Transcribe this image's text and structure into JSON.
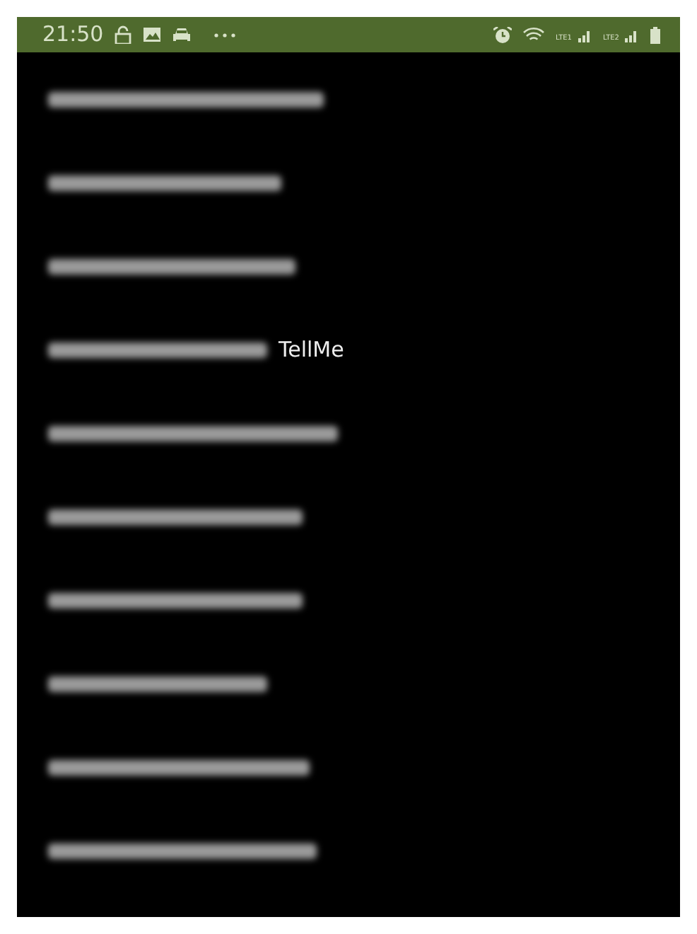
{
  "status_bar": {
    "time": "21:50",
    "sims": [
      {
        "label": "LTE1"
      },
      {
        "label": "LTE2"
      }
    ]
  },
  "devices": [
    {
      "kind": "blurred"
    },
    {
      "kind": "blurred"
    },
    {
      "kind": "blurred"
    },
    {
      "kind": "blurred_with_name",
      "name": "TellMe"
    },
    {
      "kind": "blurred"
    },
    {
      "kind": "blurred"
    },
    {
      "kind": "blurred"
    },
    {
      "kind": "blurred"
    },
    {
      "kind": "blurred"
    },
    {
      "kind": "blurred"
    }
  ]
}
